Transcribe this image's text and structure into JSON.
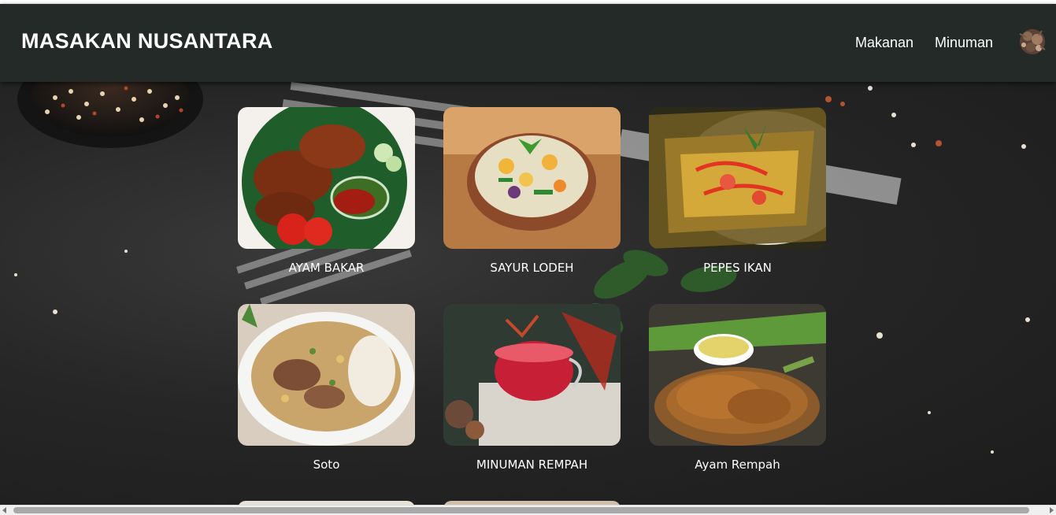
{
  "header": {
    "brand": "MASAKAN NUSANTARA",
    "nav": [
      {
        "label": "Makanan"
      },
      {
        "label": "Minuman"
      }
    ],
    "logo_icon": "spice-logo-icon"
  },
  "menu": {
    "cards": [
      {
        "title": "AYAM BAKAR",
        "image_icon": "grilled-chicken-photo"
      },
      {
        "title": "SAYUR LODEH",
        "image_icon": "vegetable-curry-photo"
      },
      {
        "title": "PEPES IKAN",
        "image_icon": "banana-leaf-fish-photo"
      },
      {
        "title": "Soto",
        "image_icon": "soto-soup-photo"
      },
      {
        "title": "MINUMAN REMPAH",
        "image_icon": "herbal-drink-photo"
      },
      {
        "title": "Ayam Rempah",
        "image_icon": "spiced-chicken-photo"
      }
    ]
  },
  "colors": {
    "navbar": "#232a27",
    "background": "#262626",
    "text": "#ffffff"
  }
}
